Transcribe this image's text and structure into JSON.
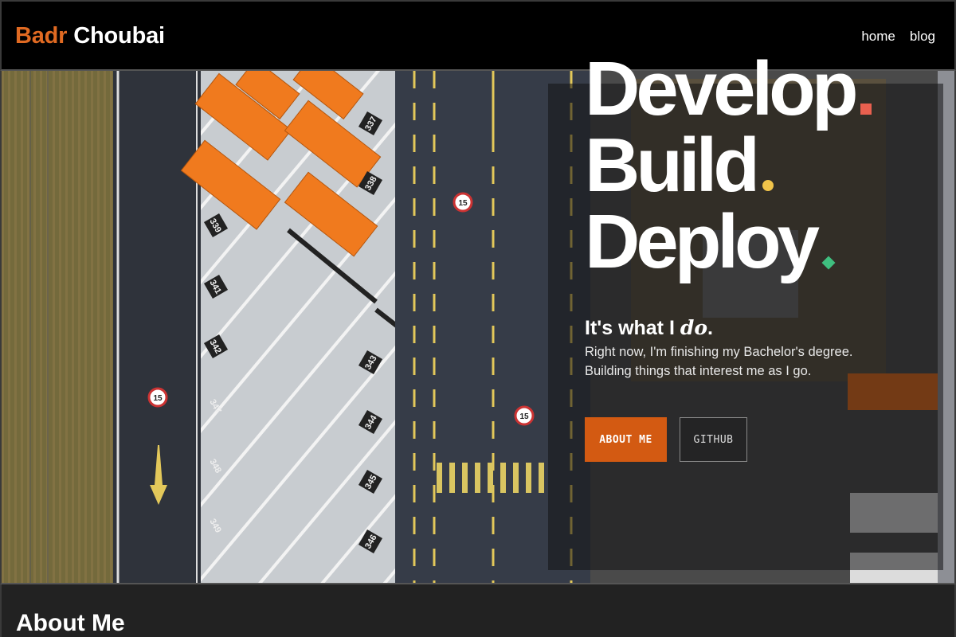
{
  "header": {
    "logo_first": "Badr",
    "logo_last": "Choubai",
    "nav": [
      {
        "label": "home"
      },
      {
        "label": "blog"
      }
    ]
  },
  "hero": {
    "headline": [
      "Develop",
      "Build",
      "Deploy"
    ],
    "tagline_prefix": "It's what I ",
    "tagline_emphasis": "do",
    "tagline_suffix": ".",
    "description_line1": "Right now, I'm finishing my Bachelor's degree.",
    "description_line2": "Building things that interest me as I go.",
    "primary_button": "ABOUT ME",
    "secondary_button": "GITHUB",
    "image_markings": {
      "spots": [
        "337",
        "338",
        "339",
        "341",
        "342",
        "343",
        "344",
        "345",
        "346",
        "347",
        "348",
        "349"
      ],
      "speed_signs": [
        "15",
        "15",
        "15"
      ]
    }
  },
  "about": {
    "title": "About Me"
  },
  "colors": {
    "accent_orange": "#e06a22",
    "button_orange": "#d35a12",
    "dot_red": "#e8604f",
    "dot_yellow": "#f1c44a",
    "dot_green": "#3fbf7f"
  }
}
